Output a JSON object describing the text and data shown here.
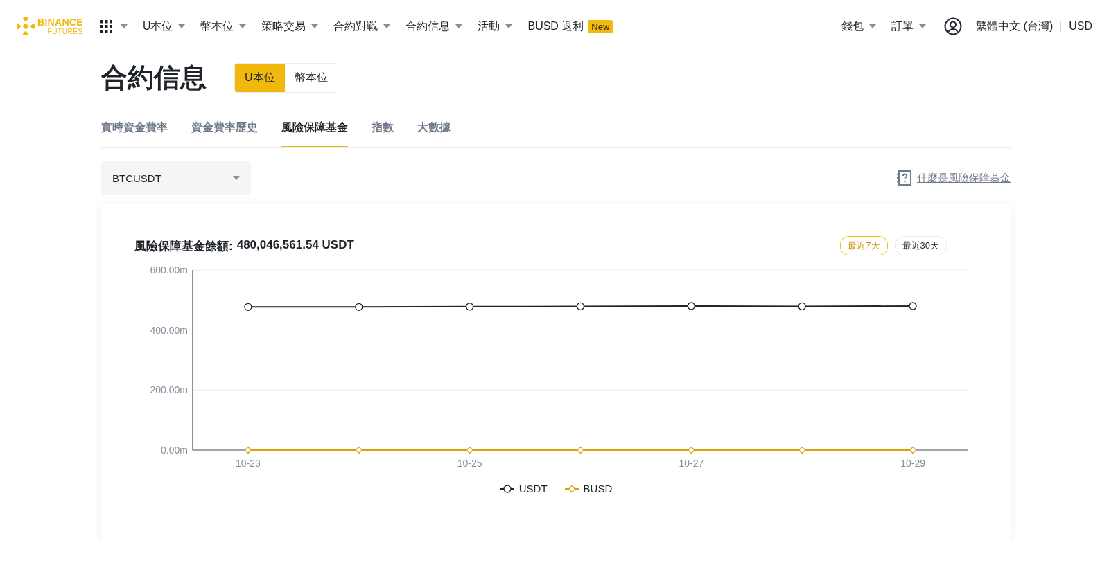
{
  "nav": {
    "logo": {
      "line1": "BINANCE",
      "line2": "FUTURES"
    },
    "menu": [
      {
        "label": "U本位",
        "caret": true
      },
      {
        "label": "幣本位",
        "caret": true
      },
      {
        "label": "策略交易",
        "caret": true
      },
      {
        "label": "合約對戰",
        "caret": true
      },
      {
        "label": "合約信息",
        "caret": true
      },
      {
        "label": "活動",
        "caret": true
      },
      {
        "label": "BUSD 返利",
        "caret": false,
        "badge": "New"
      }
    ],
    "right": [
      {
        "label": "錢包",
        "caret": true
      },
      {
        "label": "訂單",
        "caret": true
      }
    ],
    "language": "繁體中文 (台灣)",
    "currency": "USD"
  },
  "page": {
    "title": "合約信息",
    "segments": [
      {
        "label": "U本位",
        "selected": true
      },
      {
        "label": "幣本位",
        "selected": false
      }
    ],
    "tabs": [
      {
        "label": "實時資金費率",
        "selected": false
      },
      {
        "label": "資金費率歷史",
        "selected": false
      },
      {
        "label": "風險保障基金",
        "selected": true
      },
      {
        "label": "指數",
        "selected": false
      },
      {
        "label": "大數據",
        "selected": false
      }
    ],
    "symbol_select": {
      "value": "BTCUSDT"
    },
    "help_link": "什麼是風險保障基金",
    "card": {
      "balance_label": "風險保障基金餘額:",
      "balance_value": "480,046,561.54 USDT",
      "ranges": [
        {
          "label": "最近7天",
          "selected": true
        },
        {
          "label": "最近30天",
          "selected": false
        }
      ],
      "chart_data": {
        "type": "line",
        "categories": [
          "10-23",
          null,
          "10-25",
          null,
          "10-27",
          null,
          "10-29"
        ],
        "series": [
          {
            "name": "USDT",
            "color": "#1e2329",
            "marker": "circle",
            "values": [
              477,
              477,
              478,
              479,
              480,
              479,
              480
            ]
          },
          {
            "name": "BUSD",
            "color": "#d9a20b",
            "marker": "diamond",
            "values": [
              0,
              0,
              0,
              0,
              0,
              0,
              0
            ]
          }
        ],
        "ylim": [
          0,
          600
        ],
        "yticks": [
          {
            "value": 0,
            "label": "0.00m"
          },
          {
            "value": 200,
            "label": "200.00m"
          },
          {
            "value": 400,
            "label": "400.00m"
          },
          {
            "value": 600,
            "label": "600.00m"
          }
        ]
      }
    }
  }
}
